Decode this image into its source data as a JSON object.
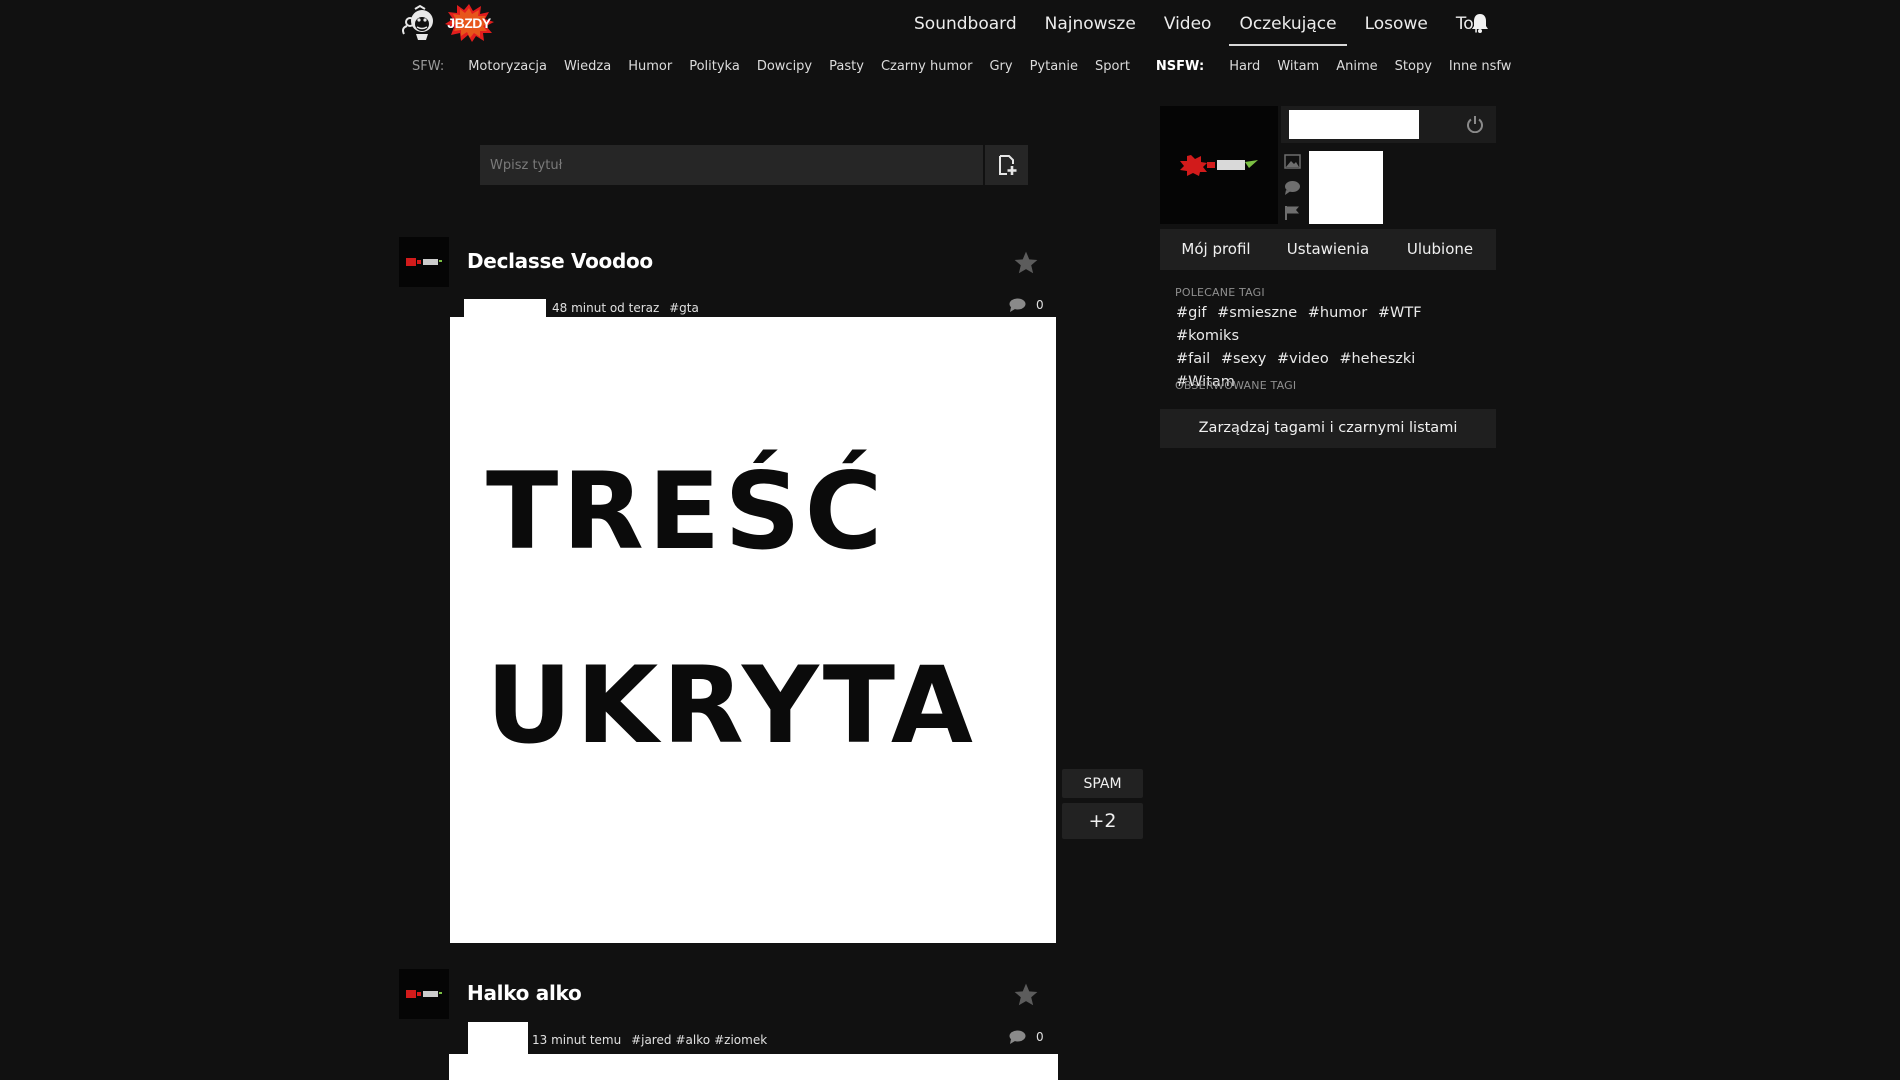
{
  "header": {
    "logo_text": "JBZDY",
    "nav": [
      "Soundboard",
      "Najnowsze",
      "Video",
      "Oczekujące",
      "Losowe",
      "Top"
    ],
    "active_nav": "Oczekujące"
  },
  "subnav": {
    "sfw_label": "SFW:",
    "sfw": [
      "Motoryzacja",
      "Wiedza",
      "Humor",
      "Polityka",
      "Dowcipy",
      "Pasty",
      "Czarny humor",
      "Gry",
      "Pytanie",
      "Sport"
    ],
    "nsfw_label": "NSFW:",
    "nsfw": [
      "Hard",
      "Witam",
      "Anime",
      "Stopy",
      "Inne nsfw"
    ]
  },
  "add_post": {
    "placeholder": "Wpisz tytuł"
  },
  "posts": [
    {
      "title": "Declasse Voodoo",
      "time": "48 minut od teraz",
      "tags": [
        "#gta"
      ],
      "comments": "0",
      "image_text": [
        "TREŚĆ",
        "UKRYTA"
      ],
      "spam_label": "SPAM",
      "votes": "+2"
    },
    {
      "title": "Halko alko",
      "time": "13 minut temu",
      "tags": [
        "#jared",
        "#alko",
        "#ziomek"
      ],
      "comments": "0"
    }
  ],
  "sidebar": {
    "tabs": [
      "Mój profil",
      "Ustawienia",
      "Ulubione"
    ],
    "recommended_label": "POLECANE TAGI",
    "recommended_tags": [
      "#gif",
      "#smieszne",
      "#humor",
      "#WTF",
      "#komiks",
      "#fail",
      "#sexy",
      "#video",
      "#heheszki",
      "#Witam"
    ],
    "observed_label": "OBSERWOWANE TAGI",
    "manage_button": "Zarządzaj tagami i czarnymi listami"
  }
}
